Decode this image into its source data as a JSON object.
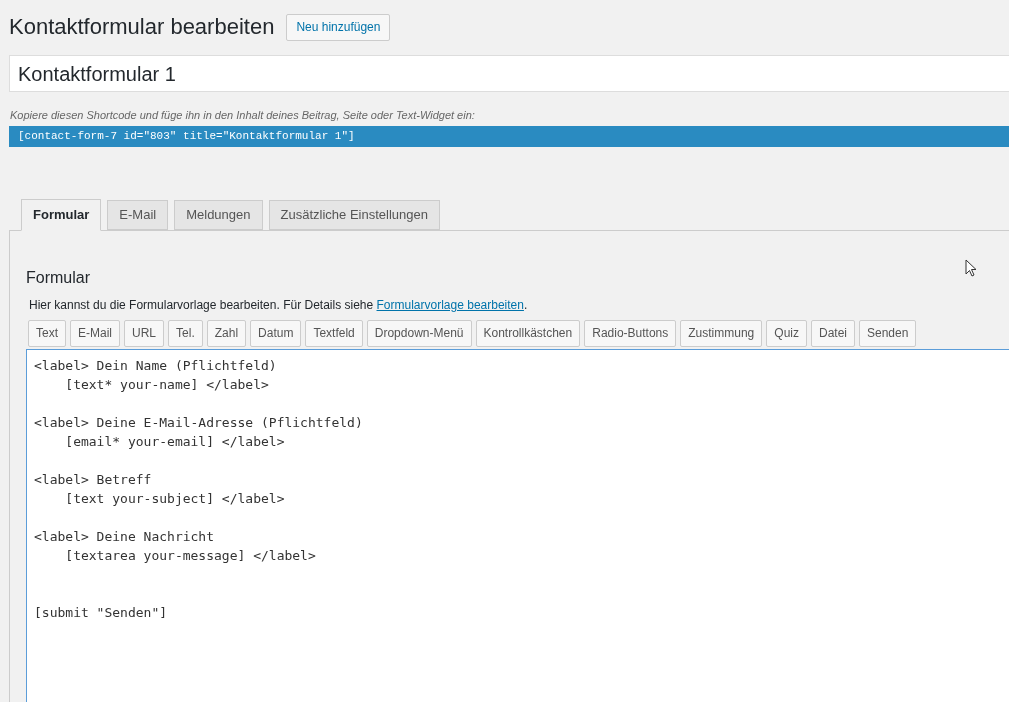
{
  "page_title": "Kontaktformular bearbeiten",
  "add_new_button": "Neu hinzufügen",
  "form_title_value": "Kontaktformular 1",
  "shortcode_hint": "Kopiere diesen Shortcode und füge ihn in den Inhalt deines Beitrag, Seite oder Text-Widget ein:",
  "shortcode": "[contact-form-7 id=\"803\" title=\"Kontaktformular 1\"]",
  "tabs": [
    {
      "label": "Formular",
      "selected": true
    },
    {
      "label": "E-Mail",
      "selected": false
    },
    {
      "label": "Meldungen",
      "selected": false
    },
    {
      "label": "Zusätzliche Einstellungen",
      "selected": false
    }
  ],
  "panel": {
    "heading": "Formular",
    "description": "Hier kannst du die Formularvorlage bearbeiten. Für Details siehe",
    "link": "Formularvorlage bearbeiten",
    "description_end": ".",
    "tag_buttons": [
      "Text",
      "E-Mail",
      "URL",
      "Tel.",
      "Zahl",
      "Datum",
      "Textfeld",
      "Dropdown-Menü",
      "Kontrollkästchen",
      "Radio-Buttons",
      "Zustimmung",
      "Quiz",
      "Datei",
      "Senden"
    ],
    "editor_value": "<label> Dein Name (Pflichtfeld)\n    [text* your-name] </label>\n\n<label> Deine E-Mail-Adresse (Pflichtfeld)\n    [email* your-email] </label>\n\n<label> Betreff\n    [text your-subject] </label>\n\n<label> Deine Nachricht\n    [textarea your-message] </label>\n\n\n[submit \"Senden\"]"
  }
}
